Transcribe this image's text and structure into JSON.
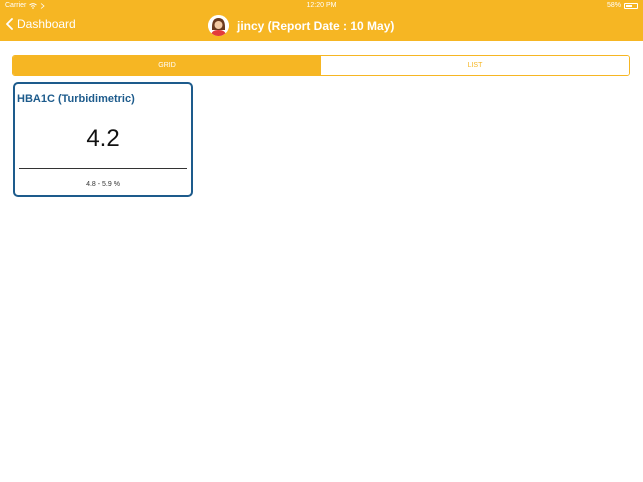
{
  "status_bar": {
    "carrier": "Carrier",
    "time": "12:20 PM",
    "battery": "58%",
    "battery_level": 0.58
  },
  "nav": {
    "back_label": "Dashboard",
    "title": "jincy (Report Date : 10 May)"
  },
  "tabs": [
    {
      "label": "GRID",
      "active": true
    },
    {
      "label": "LIST",
      "active": false
    }
  ],
  "card": {
    "test_name": "HBA1C (Turbidimetric)",
    "value": "4.2",
    "range": "4.8 - 5.9 %"
  },
  "colors": {
    "accent": "#f6b623",
    "card_border": "#1d5b8c"
  }
}
